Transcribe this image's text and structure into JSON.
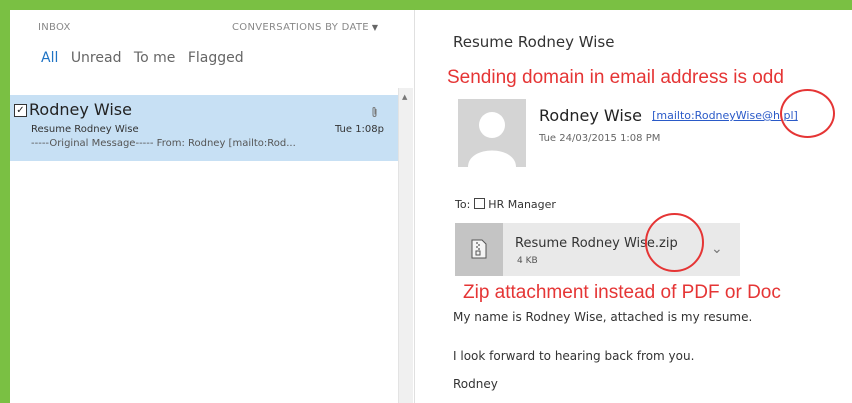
{
  "list": {
    "inbox_label": "INBOX",
    "sort_label": "CONVERSATIONS BY DATE",
    "filters": [
      "All",
      "Unread",
      "To me",
      "Flagged"
    ],
    "message": {
      "sender": "Rodney Wise",
      "subject": "Resume Rodney Wise",
      "date": "Tue 1:08p",
      "preview": "-----Original Message----- From: Rodney [mailto:Rod..."
    }
  },
  "reading": {
    "subject": "Resume Rodney Wise",
    "from_name": "Rodney Wise",
    "from_email": "[mailto:RodneyWise@h.pl]",
    "sent_date": "Tue 24/03/2015 1:08 PM",
    "to_label": "To:",
    "to_recipient": "HR Manager",
    "attachment": {
      "name": "Resume Rodney Wise.zip",
      "size": "4 KB"
    },
    "body": [
      "My name is Rodney Wise, attached is my resume.",
      "I look forward to hearing back from you.",
      "Rodney"
    ]
  },
  "annotations": {
    "domain_note": "Sending domain in email address is odd",
    "zip_note": "Zip attachment instead of PDF or Doc"
  },
  "colors": {
    "frame_green": "#7ac043",
    "selected_row": "#c7e0f4",
    "accent_blue": "#1f73c4",
    "annotation_red": "#e53535"
  }
}
